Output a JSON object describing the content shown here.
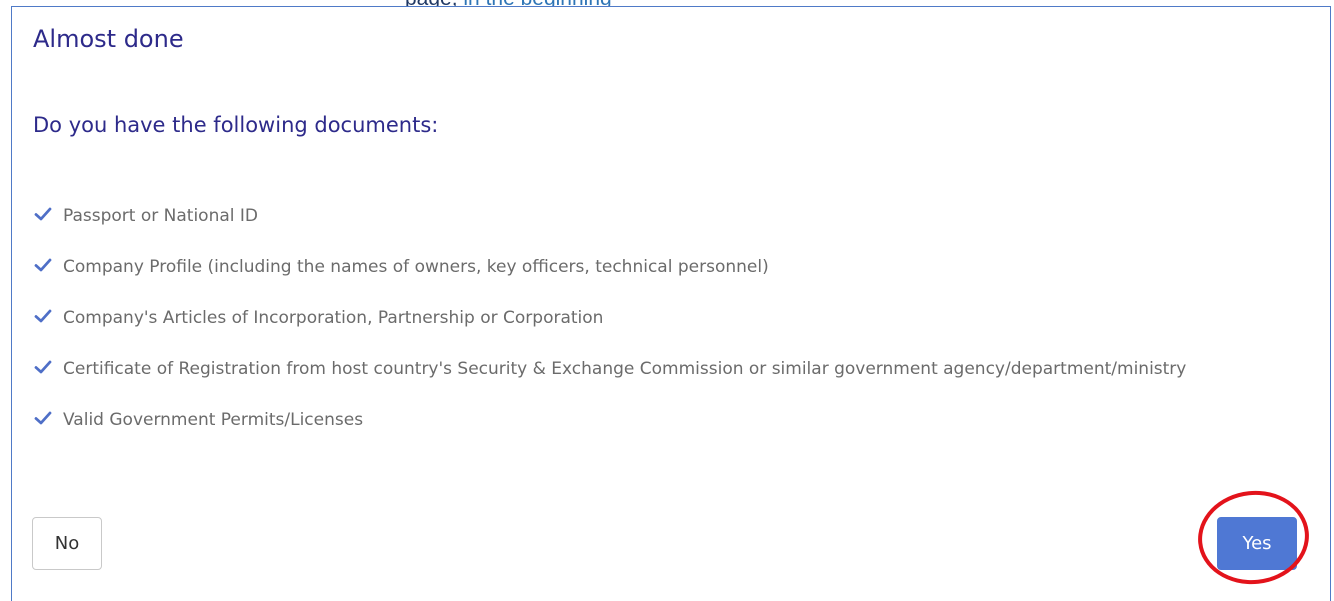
{
  "page_strip": {
    "text_prefix": "page, ",
    "text_link": "in the beginning"
  },
  "modal": {
    "title": "Almost done",
    "subtitle": "Do you have the following documents:",
    "documents": [
      {
        "label": "Passport or National ID"
      },
      {
        "label": "Company Profile (including the names of owners, key officers, technical personnel)"
      },
      {
        "label": "Company's Articles of Incorporation, Partnership or Corporation"
      },
      {
        "label": "Certificate of Registration from host country's Security & Exchange Commission or similar government agency/department/ministry"
      },
      {
        "label": "Valid Government Permits/Licenses"
      }
    ],
    "buttons": {
      "no_label": "No",
      "yes_label": "Yes"
    }
  },
  "colors": {
    "title": "#2d2a8a",
    "check": "#4f6fc7",
    "yes_button": "#4f78d4",
    "annotation_ring": "#e3131b",
    "border": "#4f7ac7"
  },
  "icons": {
    "list_bullet": "check-icon"
  }
}
